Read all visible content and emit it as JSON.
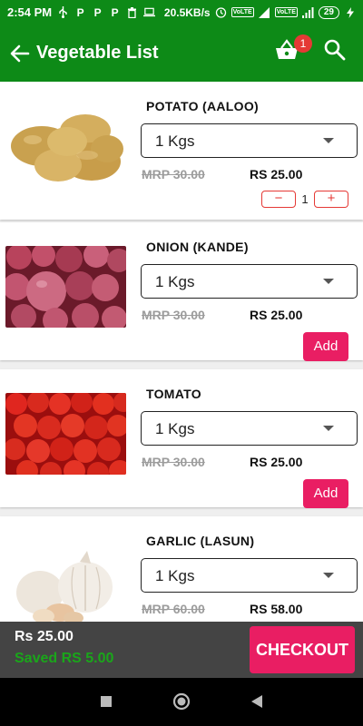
{
  "statusbar": {
    "time": "2:54 PM",
    "left_icons": [
      "usb-icon",
      "paytm-p-icon",
      "paytm-p-icon",
      "paytm-p-icon",
      "trash-icon",
      "laptop-icon"
    ],
    "speed": "20.5KB/s",
    "volte1": "VoLTE",
    "net": "4G",
    "volte2": "VoLTE",
    "battery": "29"
  },
  "appbar": {
    "title": "Vegetable List",
    "cart_count": "1"
  },
  "items": [
    {
      "name": "POTATO (AALOO)",
      "unit": "1 Kgs",
      "mrp": "MRP 30.00",
      "price": "RS 25.00",
      "qty": "1",
      "minus": "−",
      "plus": "+"
    },
    {
      "name": "ONION (KANDE)",
      "unit": "1 Kgs",
      "mrp": "MRP 30.00",
      "price": "RS 25.00",
      "add_label": "Add"
    },
    {
      "name": "TOMATO",
      "unit": "1 Kgs",
      "mrp": "MRP 30.00",
      "price": "RS 25.00",
      "add_label": "Add"
    },
    {
      "name": "GARLIC (LASUN)",
      "unit": "1 Kgs",
      "mrp": "MRP 60.00",
      "price": "RS 58.00"
    }
  ],
  "bottom": {
    "total": "Rs 25.00",
    "saved": "Saved RS 5.00",
    "checkout": "CHECKOUT"
  },
  "colors": {
    "primary_green": "#0d8a17",
    "accent_pink": "#e91e63",
    "bottom_bar": "#444444",
    "saved_green": "#1aa61a"
  }
}
